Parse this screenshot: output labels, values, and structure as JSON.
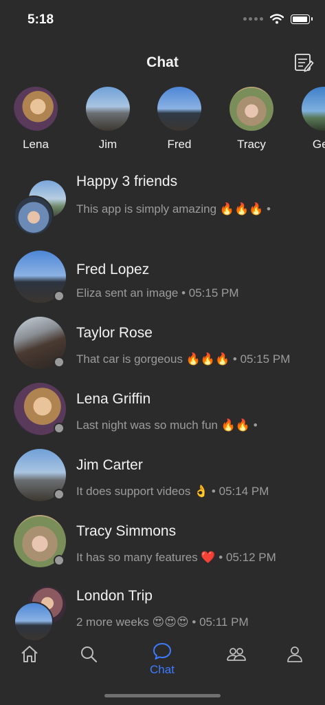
{
  "status_bar": {
    "time": "5:18"
  },
  "header": {
    "title": "Chat",
    "compose_icon": "compose-icon"
  },
  "stories": [
    {
      "name": "Lena"
    },
    {
      "name": "Jim"
    },
    {
      "name": "Fred"
    },
    {
      "name": "Tracy"
    },
    {
      "name": "Geo"
    }
  ],
  "chats": [
    {
      "title": "Happy 3 friends",
      "preview": "This app is simply amazing 🔥🔥🔥 •"
    },
    {
      "title": "Fred Lopez",
      "preview": "Eliza sent an image • 05:15 PM"
    },
    {
      "title": "Taylor Rose",
      "preview": "That car is gorgeous 🔥🔥🔥 • 05:15 PM"
    },
    {
      "title": "Lena Griffin",
      "preview": "Last night was so much fun 🔥🔥 •"
    },
    {
      "title": "Jim Carter",
      "preview": "It does support videos 👌 • 05:14 PM"
    },
    {
      "title": "Tracy Simmons",
      "preview": "It has so many features ❤️ • 05:12 PM"
    },
    {
      "title": "London Trip",
      "preview": "2 more weeks 😍😍😍 • 05:11 PM"
    }
  ],
  "tab_bar": {
    "active_label": "Chat",
    "icons": [
      "home-icon",
      "search-icon",
      "chat-bubble-icon",
      "friends-icon",
      "profile-icon"
    ]
  },
  "colors": {
    "background": "#2b2b2b",
    "accent": "#3d7bff",
    "secondary_text": "#9c9c9c"
  }
}
